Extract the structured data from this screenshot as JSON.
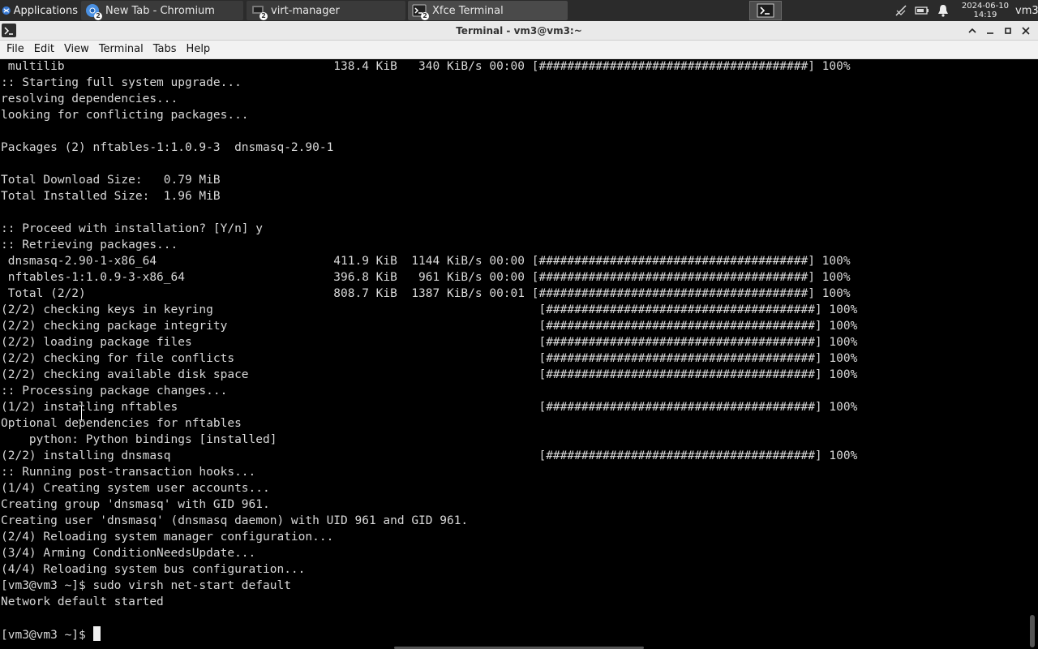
{
  "panel": {
    "apps_label": "Applications",
    "tasks": [
      {
        "label": "New Tab - Chromium",
        "icon": "chromium-icon",
        "badge": "2"
      },
      {
        "label": "virt-manager",
        "icon": "virt-manager-icon",
        "badge": "2"
      },
      {
        "label": "Xfce Terminal",
        "icon": "terminal-icon",
        "badge": "2"
      }
    ],
    "date": "2024-06-10",
    "time": "14:19",
    "user": "vm3"
  },
  "window": {
    "title": "Terminal - vm3@vm3:~"
  },
  "menu": [
    "File",
    "Edit",
    "View",
    "Terminal",
    "Tabs",
    "Help"
  ],
  "terminal": {
    "lines": [
      " multilib                                      138.4 KiB   340 KiB/s 00:00 [######################################] 100%",
      ":: Starting full system upgrade...",
      "resolving dependencies...",
      "looking for conflicting packages...",
      "",
      "Packages (2) nftables-1:1.0.9-3  dnsmasq-2.90-1",
      "",
      "Total Download Size:   0.79 MiB",
      "Total Installed Size:  1.96 MiB",
      "",
      ":: Proceed with installation? [Y/n] y",
      ":: Retrieving packages...",
      " dnsmasq-2.90-1-x86_64                         411.9 KiB  1144 KiB/s 00:00 [######################################] 100%",
      " nftables-1:1.0.9-3-x86_64                     396.8 KiB   961 KiB/s 00:00 [######################################] 100%",
      " Total (2/2)                                   808.7 KiB  1387 KiB/s 00:01 [######################################] 100%",
      "(2/2) checking keys in keyring                                              [######################################] 100%",
      "(2/2) checking package integrity                                            [######################################] 100%",
      "(2/2) loading package files                                                 [######################################] 100%",
      "(2/2) checking for file conflicts                                           [######################################] 100%",
      "(2/2) checking available disk space                                         [######################################] 100%",
      ":: Processing package changes...",
      "(1/2) installing nftables                                                   [######################################] 100%",
      "Optional dependencies for nftables",
      "    python: Python bindings [installed]",
      "(2/2) installing dnsmasq                                                    [######################################] 100%",
      ":: Running post-transaction hooks...",
      "(1/4) Creating system user accounts...",
      "Creating group 'dnsmasq' with GID 961.",
      "Creating user 'dnsmasq' (dnsmasq daemon) with UID 961 and GID 961.",
      "(2/4) Reloading system manager configuration...",
      "(3/4) Arming ConditionNeedsUpdate...",
      "(4/4) Reloading system bus configuration...",
      "[vm3@vm3 ~]$ sudo virsh net-start default",
      "Network default started",
      ""
    ],
    "prompt": "[vm3@vm3 ~]$ "
  },
  "colors": {
    "panel_bg": "#2b2b2b",
    "titlebar_bg": "#e9e9e9",
    "terminal_bg": "#000000",
    "terminal_fg": "#d8d8d8"
  }
}
